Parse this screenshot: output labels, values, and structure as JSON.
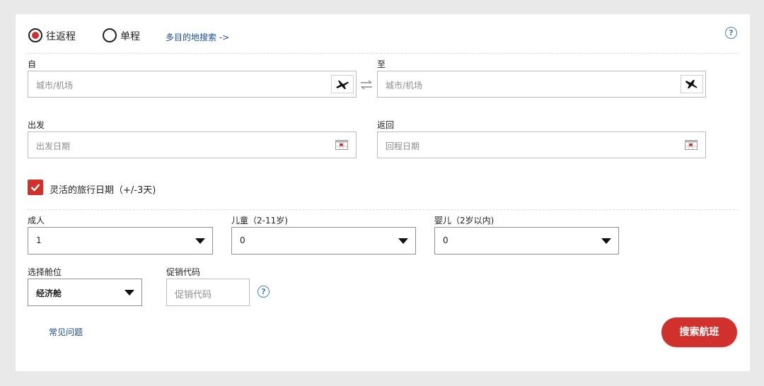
{
  "trip_type": {
    "round_trip_label": "往返程",
    "one_way_label": "单程",
    "multi_city_link": "多目的地搜索 ->"
  },
  "help_icon": "?",
  "from": {
    "label": "自",
    "placeholder": "城市/机场"
  },
  "to": {
    "label": "至",
    "placeholder": "城市/机场"
  },
  "depart": {
    "label": "出发",
    "placeholder": "出发日期"
  },
  "return": {
    "label": "返回",
    "placeholder": "回程日期"
  },
  "flexible": {
    "label": "灵活的旅行日期（+/-3天)",
    "checked": true
  },
  "passengers": {
    "adults": {
      "label": "成人",
      "value": "1"
    },
    "children": {
      "label": "儿童（2-11岁)",
      "value": "0"
    },
    "infants": {
      "label": "婴儿（2岁以内)",
      "value": "0"
    }
  },
  "cabin": {
    "label": "选择舱位",
    "value": "经济舱"
  },
  "promo": {
    "label": "促销代码",
    "placeholder": "促销代码"
  },
  "faq_link": "常见问题",
  "search_button": "搜索航班",
  "colors": {
    "accent": "#d0312d",
    "link": "#1c4c95",
    "help": "#4a7ebf"
  },
  "icons": {
    "from": "plane-departure-icon",
    "to": "plane-arrival-icon",
    "swap": "swap-arrows-icon",
    "calendar": "calendar-icon",
    "dropdown": "chevron-down-icon",
    "check": "checkmark-icon",
    "help": "help-circle-icon"
  }
}
